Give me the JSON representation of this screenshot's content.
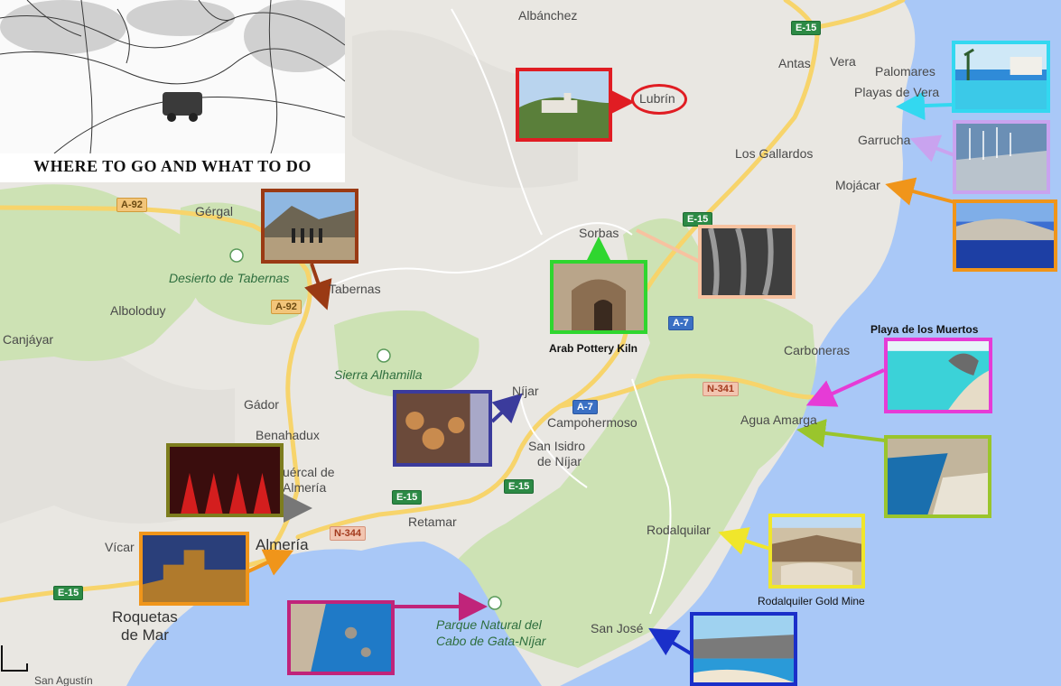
{
  "map": {
    "colors": {
      "sea": "#a9c8f7",
      "land": "#e9e7e2",
      "park": "#c8dfae",
      "road": "#f7d46b",
      "hill": "#dcdad4"
    },
    "places": [
      {
        "id": "albanchez",
        "name": "Albánchez"
      },
      {
        "id": "antas",
        "name": "Antas"
      },
      {
        "id": "vera",
        "name": "Vera"
      },
      {
        "id": "palomares",
        "name": "Palomares"
      },
      {
        "id": "playas_vera",
        "name": "Playas de Vera"
      },
      {
        "id": "garrucha",
        "name": "Garrucha"
      },
      {
        "id": "los_gallardos",
        "name": "Los Gallardos"
      },
      {
        "id": "mojacar",
        "name": "Mojácar"
      },
      {
        "id": "lubrin",
        "name": "Lubrín"
      },
      {
        "id": "gergal",
        "name": "Gérgal"
      },
      {
        "id": "sorbas",
        "name": "Sorbas"
      },
      {
        "id": "tabernas",
        "name": "Tabernas"
      },
      {
        "id": "alboloduy",
        "name": "Alboloduy"
      },
      {
        "id": "canjayar",
        "name": "Canjáyar"
      },
      {
        "id": "carboneras",
        "name": "Carboneras"
      },
      {
        "id": "gador",
        "name": "Gádor"
      },
      {
        "id": "nijar",
        "name": "Níjar"
      },
      {
        "id": "campohermoso",
        "name": "Campohermoso"
      },
      {
        "id": "agua_amarga",
        "name": "Agua Amarga"
      },
      {
        "id": "benahadux",
        "name": "Benahadux"
      },
      {
        "id": "san_isidro_1",
        "name": "San Isidro"
      },
      {
        "id": "san_isidro_2",
        "name": "de Níjar"
      },
      {
        "id": "huercal_1",
        "name": "uércal de"
      },
      {
        "id": "huercal_2",
        "name": "Almería"
      },
      {
        "id": "retamar",
        "name": "Retamar"
      },
      {
        "id": "rodalquilar",
        "name": "Rodalquilar"
      },
      {
        "id": "vicar",
        "name": "Vícar"
      },
      {
        "id": "almeria",
        "name": "Almería"
      },
      {
        "id": "roquetas_1",
        "name": "Roquetas"
      },
      {
        "id": "roquetas_2",
        "name": "de Mar"
      },
      {
        "id": "san_jose",
        "name": "San José"
      },
      {
        "id": "san_agustin",
        "name": "San Agustín"
      }
    ],
    "parks": [
      {
        "id": "desierto",
        "name": "Desierto de Tabernas"
      },
      {
        "id": "alhamilla",
        "name": "Sierra Alhamilla"
      },
      {
        "id": "cabo_1",
        "name": "Parque Natural del"
      },
      {
        "id": "cabo_2",
        "name": "Cabo de Gata-Níjar"
      }
    ],
    "roads": [
      {
        "id": "e15_top",
        "label": "E-15",
        "kind": "e"
      },
      {
        "id": "e15_sorbas",
        "label": "E-15",
        "kind": "e"
      },
      {
        "id": "e15_alm",
        "label": "E-15",
        "kind": "e"
      },
      {
        "id": "e15_san",
        "label": "E-15",
        "kind": "e"
      },
      {
        "id": "e15_roq",
        "label": "E-15",
        "kind": "e"
      },
      {
        "id": "a92_1",
        "label": "A-92",
        "kind": "a"
      },
      {
        "id": "a92_2",
        "label": "A-92",
        "kind": "a"
      },
      {
        "id": "a7_1",
        "label": "A-7",
        "kind": "a7"
      },
      {
        "id": "a7_2",
        "label": "A-7",
        "kind": "a7"
      },
      {
        "id": "n341",
        "label": "N-341",
        "kind": "n"
      },
      {
        "id": "n344",
        "label": "N-344",
        "kind": "n"
      }
    ]
  },
  "banner": {
    "title": "WHERE TO GO AND WHAT TO DO",
    "scene": "sketch of a car on a tree-lined road"
  },
  "photos": [
    {
      "id": "lubrin",
      "scene": "hill village",
      "frame": "#e01d23"
    },
    {
      "id": "playas_vera",
      "scene": "pool resort",
      "frame": "#33d8f0"
    },
    {
      "id": "garrucha",
      "scene": "marina",
      "frame": "#c9a3ef"
    },
    {
      "id": "mojacar",
      "scene": "coastal town",
      "frame": "#f0951a"
    },
    {
      "id": "tabernas",
      "scene": "western film set",
      "frame": "#9a3a14"
    },
    {
      "id": "sorbas_caves",
      "scene": "caves",
      "frame": "#f7c2a0"
    },
    {
      "id": "kiln",
      "scene": "pottery kiln",
      "frame": "#2fd62f"
    },
    {
      "id": "muertos",
      "scene": "beach cove",
      "frame": "#e63bd6"
    },
    {
      "id": "agua_amarga",
      "scene": "bay beach",
      "frame": "#9ac52c"
    },
    {
      "id": "nijar",
      "scene": "pottery shop",
      "frame": "#3b3b9c"
    },
    {
      "id": "flamenco",
      "scene": "flamenco dancers",
      "frame": "#7d7d1e"
    },
    {
      "id": "alcazaba",
      "scene": "fortress",
      "frame": "#f0951a"
    },
    {
      "id": "rodalquilar",
      "scene": "mine ruins",
      "frame": "#f0e62b"
    },
    {
      "id": "cabo",
      "scene": "rocky coast",
      "frame": "#c0247a"
    },
    {
      "id": "san_jose",
      "scene": "beach",
      "frame": "#1a2fc9"
    }
  ],
  "captions": {
    "kiln": "Arab Pottery Kiln",
    "muertos": "Playa de los Muertos",
    "rodalquilar": "Rodalquiler Gold Mine"
  }
}
